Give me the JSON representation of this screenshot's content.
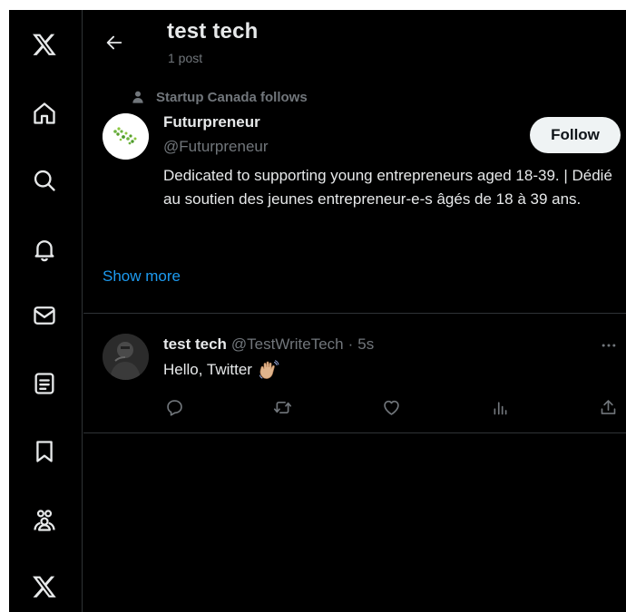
{
  "header": {
    "title": "test tech",
    "post_count": "1 post"
  },
  "suggestion": {
    "social_context": "Startup Canada follows",
    "name": "Futurpreneur",
    "handle": "@Futurpreneur",
    "follow_label": "Follow",
    "bio": "Dedicated to supporting young entrepreneurs aged 18-39. | Dédié au soutien des jeunes entrepreneur-e-s âgés de 18 à 39 ans.",
    "show_more": "Show more"
  },
  "tweet": {
    "name": "test tech",
    "handle": "@TestWriteTech",
    "separator": "·",
    "time": "5s",
    "text": "Hello, Twitter"
  },
  "icons": {
    "nav": [
      "x-logo-icon",
      "home-icon",
      "search-icon",
      "notifications-icon",
      "messages-icon",
      "lists-icon",
      "bookmarks-icon",
      "communities-icon",
      "premium-x-icon"
    ],
    "back": "back-arrow-icon",
    "more": "more-icon",
    "emoji": "waving-hand-emoji-icon",
    "actions": [
      "reply-icon",
      "retweet-icon",
      "like-icon",
      "views-icon",
      "share-icon"
    ]
  },
  "colors": {
    "background": "#000000",
    "text": "#e7e9ea",
    "secondary_text": "#71767b",
    "link": "#1d9bf0",
    "border": "#2f3336",
    "follow_button_bg": "#eff3f4"
  }
}
